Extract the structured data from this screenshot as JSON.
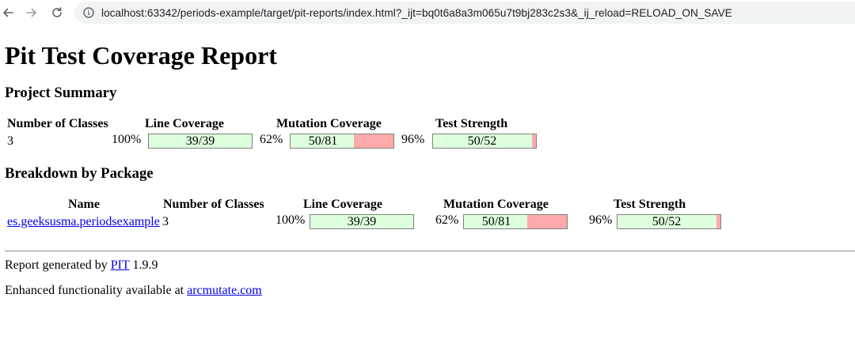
{
  "browser": {
    "url": "localhost:63342/periods-example/target/pit-reports/index.html?_ijt=bq0t6a8a3m065u7t9bj283c2s3&_ij_reload=RELOAD_ON_SAVE"
  },
  "page": {
    "title": "Pit Test Coverage Report",
    "project_summary": {
      "heading": "Project Summary",
      "headers": {
        "classes": "Number of Classes",
        "line": "Line Coverage",
        "mutation": "Mutation Coverage",
        "strength": "Test Strength"
      },
      "classes": "3",
      "line": {
        "percent": "100%",
        "text": "39/39",
        "fraction": 1.0
      },
      "mutation": {
        "percent": "62%",
        "text": "50/81",
        "fraction": 0.617
      },
      "strength": {
        "percent": "96%",
        "text": "50/52",
        "fraction": 0.962
      }
    },
    "breakdown": {
      "heading": "Breakdown by Package",
      "headers": {
        "name": "Name",
        "classes": "Number of Classes",
        "line": "Line Coverage",
        "mutation": "Mutation Coverage",
        "strength": "Test Strength"
      },
      "rows": [
        {
          "name": "es.geeksusma.periodsexample",
          "classes": "3",
          "line": {
            "percent": "100%",
            "text": "39/39",
            "fraction": 1.0
          },
          "mutation": {
            "percent": "62%",
            "text": "50/81",
            "fraction": 0.617
          },
          "strength": {
            "percent": "96%",
            "text": "50/52",
            "fraction": 0.962
          }
        }
      ]
    },
    "footer": {
      "generated_prefix": "Report generated by",
      "pit_link": "PIT",
      "version": "1.9.9",
      "enhanced_prefix": "Enhanced functionality available at",
      "arcmutate_link": "arcmutate.com"
    }
  },
  "colors": {
    "covered": "#ddffdd",
    "uncovered": "#ffaaaa",
    "link": "#0000ee"
  }
}
